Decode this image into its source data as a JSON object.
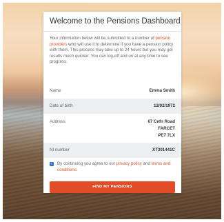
{
  "card": {
    "title": "Welcome to the Pensions Dashboard",
    "intro": {
      "before": "Your information below will be submitted to a number of ",
      "link": "pension providers",
      "after": " who will use it to determine if you have a pension policy with them. This process may take up to 24 hours but you may get results much quicker. You can log-off and on at any time to see progress."
    },
    "details": [
      {
        "label": "Name",
        "value_lines": [
          "Emma Smith"
        ]
      },
      {
        "label": "Date of birth",
        "value_lines": [
          "12/02/1972"
        ]
      },
      {
        "label": "Address",
        "value_lines": [
          "67 Cefn Road",
          "FARCET",
          "PE7 7LX"
        ]
      },
      {
        "label": "NI number",
        "value_lines": [
          "XT301441C"
        ]
      }
    ],
    "consent": {
      "checked": true,
      "before": "By continuing you agree to our ",
      "privacy_link": "privacy policy",
      "middle": " and ",
      "terms_link": "terms and conditions",
      "after": "."
    },
    "button_label": "FIND MY PENSIONS"
  },
  "colors": {
    "accent": "#e24d27",
    "checkbox": "#2f6fd1",
    "shaded_row": "#eceeef"
  },
  "icons": {
    "checkbox": "checkmark-icon"
  }
}
